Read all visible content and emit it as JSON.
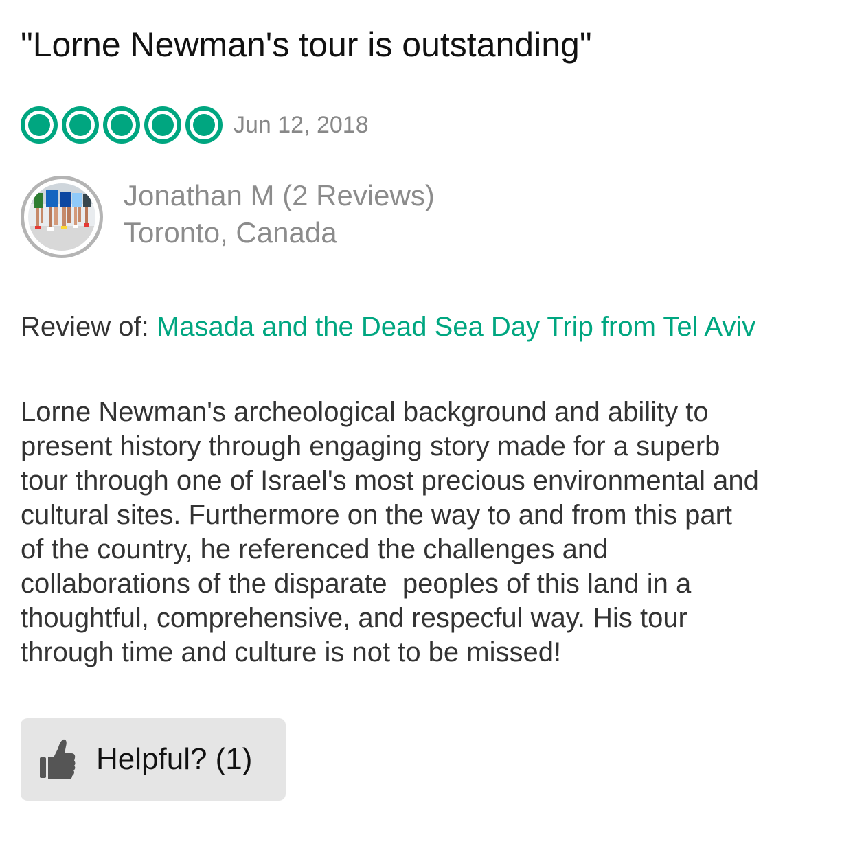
{
  "review": {
    "title": "\"Lorne Newman's tour is outstanding\"",
    "rating": {
      "value": 5,
      "max": 5,
      "color": "#00a680"
    },
    "date": "Jun 12, 2018",
    "reviewer": {
      "name_line": "Jonathan M (2 Reviews)",
      "location": "Toronto, Canada",
      "avatar_icon": "runners-photo"
    },
    "review_of": {
      "label": "Review of:",
      "link_text": "Masada and the Dead Sea Day Trip from Tel Aviv",
      "link_color": "#00a680"
    },
    "body_lines": [
      "Lorne Newman's archeological background and ability to",
      "present history through engaging story made for a superb",
      "tour through one of Israel's most precious environmental and",
      "cultural sites. Furthermore on the way to and from this part",
      "of the country, he referenced the challenges and",
      "collaborations of the disparate  peoples of this land in a",
      "thoughtful, comprehensive, and respecful way. His tour",
      "through time and culture is not to be missed!"
    ],
    "helpful": {
      "label": "Helpful? (1)",
      "icon": "thumbs-up-icon"
    }
  }
}
